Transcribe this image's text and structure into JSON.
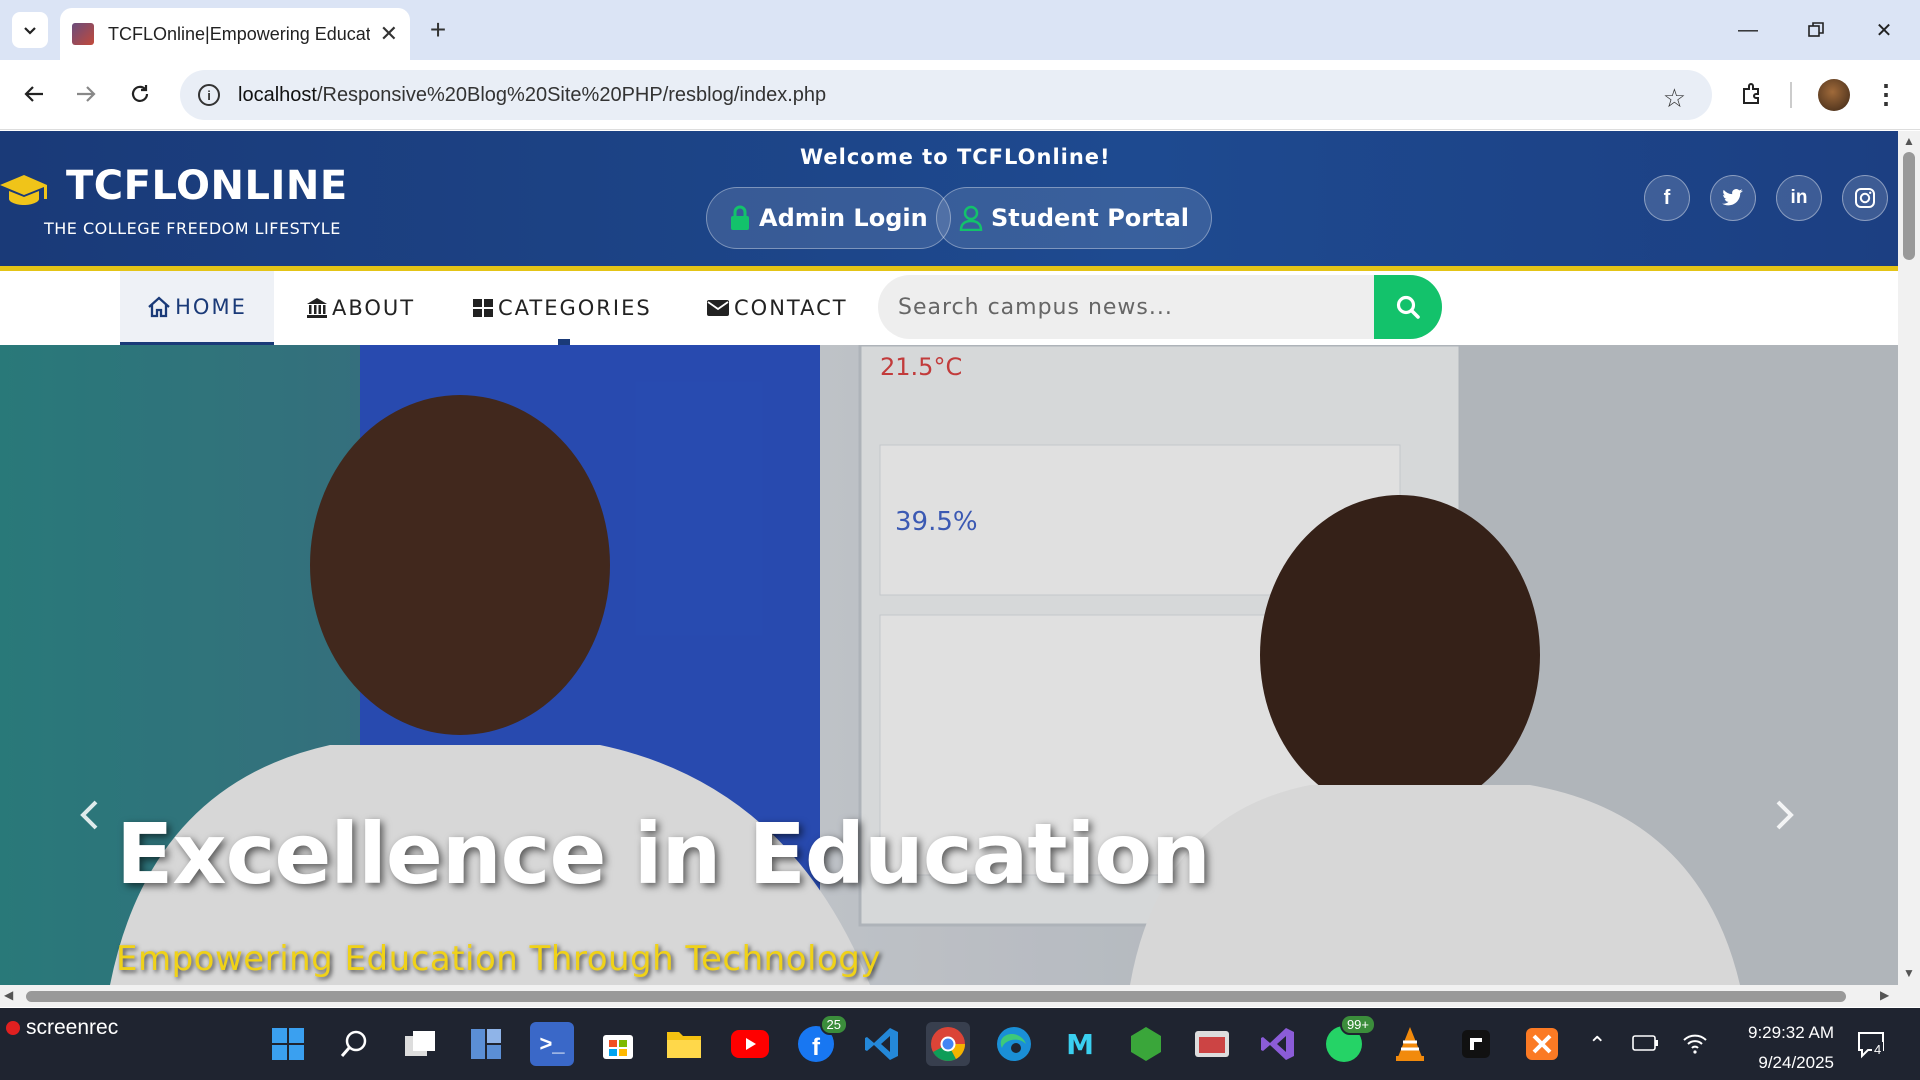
{
  "browser": {
    "tab_title": "TCFLOnline|Empowering Educati",
    "url_host": "localhost",
    "url_path": "/Responsive%20Blog%20Site%20PHP/resblog/index.php"
  },
  "header": {
    "brand": "TCFLONLINE",
    "tagline": "THE COLLEGE FREEDOM LIFESTYLE",
    "welcome": "Welcome to TCFLOnline!",
    "admin_login": "Admin Login",
    "student_portal": "Student Portal",
    "social": [
      "facebook-icon",
      "twitter-icon",
      "linkedin-icon",
      "instagram-icon"
    ]
  },
  "nav": {
    "items": [
      {
        "label": "HOME",
        "icon": "home-icon"
      },
      {
        "label": "ABOUT",
        "icon": "university-icon"
      },
      {
        "label": "CATEGORIES",
        "icon": "grid-icon"
      },
      {
        "label": "CONTACT",
        "icon": "envelope-icon"
      }
    ],
    "search_placeholder": "Search campus news..."
  },
  "hero": {
    "title": "Excellence in Education",
    "subtitle": "Empowering Education Through Technology"
  },
  "taskbar": {
    "screenrec": "screenrec",
    "time": "9:29:32 AM",
    "date": "9/24/2025",
    "facebook_badge": "25",
    "whatsapp_badge": "99+",
    "notifications": "4"
  },
  "colors": {
    "header_bg": "#1a3a78",
    "accent_yellow": "#e4c416",
    "search_green": "#13c26b",
    "subtitle_yellow": "#f0d218"
  }
}
